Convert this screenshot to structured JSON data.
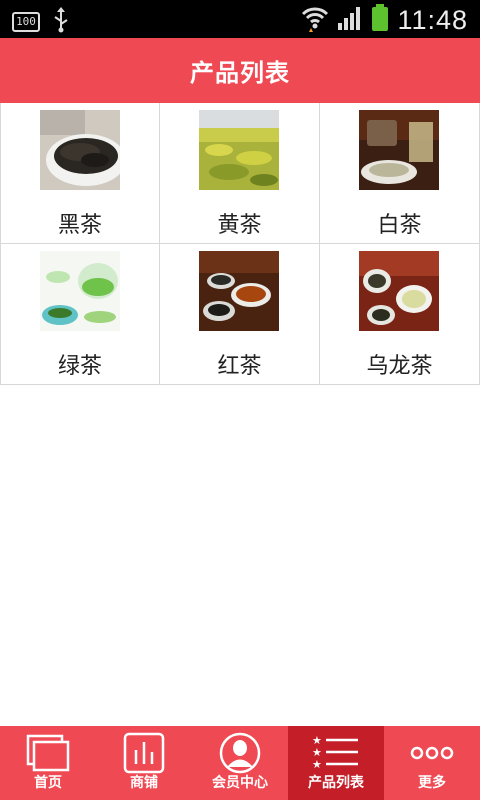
{
  "status_bar": {
    "battery_small": "100",
    "time": "11:48"
  },
  "header": {
    "title": "产品列表"
  },
  "products": [
    {
      "label": "黑茶"
    },
    {
      "label": "黄茶"
    },
    {
      "label": "白茶"
    },
    {
      "label": "绿茶"
    },
    {
      "label": "红茶"
    },
    {
      "label": "乌龙茶"
    }
  ],
  "nav": {
    "items": [
      {
        "label": "首页",
        "icon": "home-icon"
      },
      {
        "label": "商铺",
        "icon": "shop-icon"
      },
      {
        "label": "会员中心",
        "icon": "member-icon"
      },
      {
        "label": "产品列表",
        "icon": "product-list-icon"
      },
      {
        "label": "更多",
        "icon": "more-icon"
      }
    ],
    "active_index": 3
  },
  "colors": {
    "header_bg": "#ef4a54",
    "nav_active_bg": "#c41f28",
    "status_bg": "#000000"
  }
}
